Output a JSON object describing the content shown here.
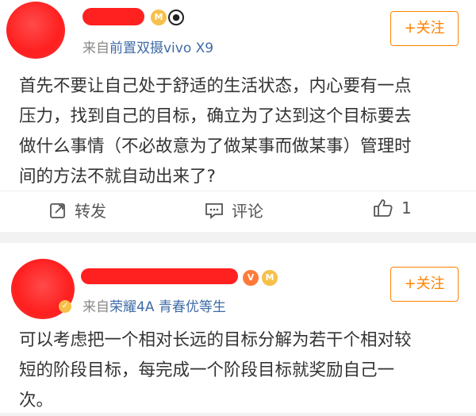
{
  "colors": {
    "accent": "#ff8200",
    "link": "#3f6ba7",
    "muted": "#8a8a8a",
    "redacted": "#ff1f1f",
    "background": "#f2f2f2"
  },
  "posts": [
    {
      "avatar": "redacted-avatar",
      "username": "",
      "badges": [
        "medal-icon",
        "panda-icon"
      ],
      "source_prefix": "来自",
      "source_device": "前置双摄vivo X9",
      "follow_label": "+关注",
      "text_lines": [
        "首先不要让自己处于舒适的生活状态，内心要有一点",
        "压力，找到自己的目标，确立为了达到这个目标要去",
        "做什么事情（不必故意为了做某事而做某事）管理时",
        "间的方法不就自动出来了?"
      ],
      "actions": {
        "repost_label": "转发",
        "comment_label": "评论",
        "like_count": "1"
      }
    },
    {
      "avatar": "redacted-avatar",
      "username": "",
      "badges": [
        "vip-icon",
        "medal-icon"
      ],
      "source_prefix": "来自",
      "source_device": "荣耀4A 青春优等生",
      "follow_label": "+关注",
      "text_lines": [
        "可以考虑把一个相对长远的目标分解为若干个相对较",
        "短的阶段目标，每完成一个阶段目标就奖励自己一",
        "次。"
      ]
    }
  ]
}
